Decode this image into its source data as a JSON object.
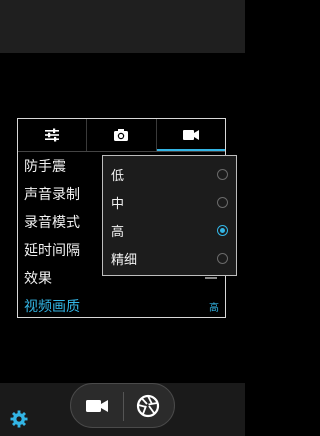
{
  "panel": {
    "tabs": [
      {
        "icon": "sliders-icon",
        "active": false
      },
      {
        "icon": "camera-icon",
        "active": false
      },
      {
        "icon": "video-camera-icon",
        "active": true
      }
    ],
    "settings": [
      {
        "label": "防手震"
      },
      {
        "label": "声音录制"
      },
      {
        "label": "录音模式"
      },
      {
        "label": "延时间隔"
      },
      {
        "label": "效果"
      },
      {
        "label": "视频画质",
        "value": "高"
      }
    ]
  },
  "dropdown": {
    "options": [
      {
        "label": "低",
        "selected": false
      },
      {
        "label": "中",
        "selected": false
      },
      {
        "label": "高",
        "selected": true
      },
      {
        "label": "精细",
        "selected": false
      }
    ]
  },
  "bottom": {
    "settings_icon": "gear-icon",
    "mode_icon": "video-camera-icon",
    "shutter_icon": "shutter-icon"
  },
  "colors": {
    "accent": "#33b5e5",
    "background": "#000000"
  }
}
